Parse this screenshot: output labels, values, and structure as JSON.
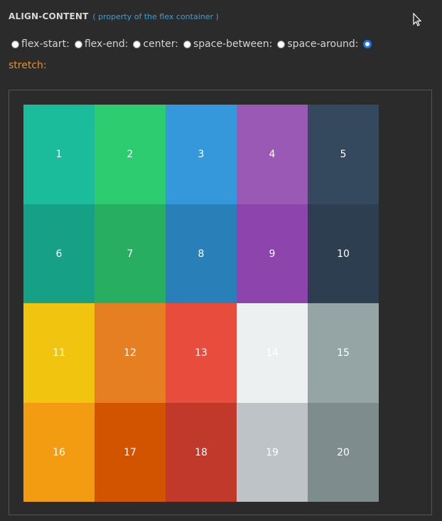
{
  "header": {
    "title": "ALIGN-CONTENT",
    "subtitle": "( property of the flex container )"
  },
  "options": [
    {
      "label": "flex-start:",
      "checked": false
    },
    {
      "label": "flex-end:",
      "checked": false
    },
    {
      "label": "center:",
      "checked": false
    },
    {
      "label": "space-between:",
      "checked": false
    },
    {
      "label": "space-around:",
      "checked": false
    },
    {
      "label": "",
      "checked": true
    }
  ],
  "selected_label": "stretch:",
  "items": [
    {
      "label": "1",
      "color": "#1abc9c"
    },
    {
      "label": "2",
      "color": "#2ecc71"
    },
    {
      "label": "3",
      "color": "#3498db"
    },
    {
      "label": "4",
      "color": "#9b59b6"
    },
    {
      "label": "5",
      "color": "#34495e"
    },
    {
      "label": "6",
      "color": "#16a085"
    },
    {
      "label": "7",
      "color": "#27ae60"
    },
    {
      "label": "8",
      "color": "#2980b9"
    },
    {
      "label": "9",
      "color": "#8e44ad"
    },
    {
      "label": "10",
      "color": "#2c3e50"
    },
    {
      "label": "11",
      "color": "#f1c40f"
    },
    {
      "label": "12",
      "color": "#e67e22"
    },
    {
      "label": "13",
      "color": "#e74c3c"
    },
    {
      "label": "14",
      "color": "#ecf0f1"
    },
    {
      "label": "15",
      "color": "#95a5a6"
    },
    {
      "label": "16",
      "color": "#f39c12"
    },
    {
      "label": "17",
      "color": "#d35400"
    },
    {
      "label": "18",
      "color": "#c0392b"
    },
    {
      "label": "19",
      "color": "#bdc3c7"
    },
    {
      "label": "20",
      "color": "#7f8c8d"
    }
  ]
}
